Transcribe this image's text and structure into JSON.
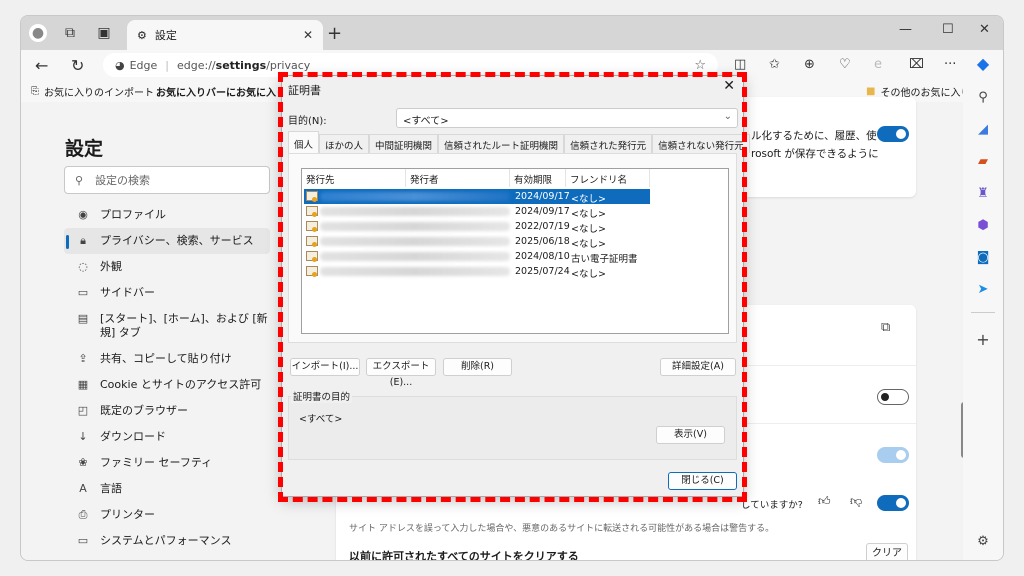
{
  "browser": {
    "tab_title": "設定",
    "url_brand": "Edge",
    "url_prefix": "edge://",
    "url_bold": "settings",
    "url_suffix": "/privacy",
    "favorites_bar": {
      "import": "お気に入りのインポート",
      "hint": "お気に入りバーにお気に入りを追",
      "other": "その他のお気に入り"
    }
  },
  "settings": {
    "title": "設定",
    "search_placeholder": "設定の検索",
    "menu": [
      {
        "icon": "profile-icon",
        "glyph": "◉",
        "label": "プロファイル"
      },
      {
        "icon": "lock-icon",
        "glyph": "🔒︎",
        "label": "プライバシー、検索、サービス",
        "active": true
      },
      {
        "icon": "appearance-icon",
        "glyph": "◌",
        "label": "外観"
      },
      {
        "icon": "sidebar-icon",
        "glyph": "▭",
        "label": "サイドバー"
      },
      {
        "icon": "newtab-icon",
        "glyph": "▤",
        "label": "[スタート]、[ホーム]、および [新規] タブ"
      },
      {
        "icon": "share-icon",
        "glyph": "⇪",
        "label": "共有、コピーして貼り付け"
      },
      {
        "icon": "cookie-icon",
        "glyph": "▦",
        "label": "Cookie とサイトのアクセス許可"
      },
      {
        "icon": "default-browser-icon",
        "glyph": "◰",
        "label": "既定のブラウザー"
      },
      {
        "icon": "download-icon",
        "glyph": "↓",
        "label": "ダウンロード"
      },
      {
        "icon": "family-icon",
        "glyph": "❀",
        "label": "ファミリー セーフティ"
      },
      {
        "icon": "language-icon",
        "glyph": "A",
        "label": "言語"
      },
      {
        "icon": "printer-icon",
        "glyph": "⎙",
        "label": "プリンター"
      },
      {
        "icon": "system-icon",
        "glyph": "▭",
        "label": "システムとパフォーマンス"
      }
    ],
    "card1_line1": "ル化するために、履歴、使",
    "card1_line2": "rosoft が保存できるように",
    "feedback_text": "していますか?",
    "typo_desc": "サイト アドレスを誤って入力した場合や、悪意のあるサイトに転送される可能性がある場合は警告する。",
    "clear_title": "以前に許可されたすべてのサイトをクリアする",
    "clear_button": "クリア"
  },
  "dialog": {
    "title": "証明書",
    "purpose_label": "目的(N):",
    "purpose_value": "<すべて>",
    "tabs": [
      "個人",
      "ほかの人",
      "中間証明機関",
      "信頼されたルート証明機関",
      "信頼された発行元",
      "信頼されない発行元"
    ],
    "columns": [
      "発行先",
      "発行者",
      "有効期限",
      "フレンドリ名"
    ],
    "rows": [
      {
        "expires": "2024/09/17",
        "friendly": "<なし>",
        "selected": true
      },
      {
        "expires": "2024/09/17",
        "friendly": "<なし>"
      },
      {
        "expires": "2022/07/19",
        "friendly": "<なし>"
      },
      {
        "expires": "2025/06/18",
        "friendly": "<なし>"
      },
      {
        "expires": "2024/08/10",
        "friendly": "古い電子証明書"
      },
      {
        "expires": "2025/07/24",
        "friendly": "<なし>"
      }
    ],
    "buttons": {
      "import": "インポート(I)...",
      "export": "エクスポート(E)...",
      "remove": "削除(R)",
      "advanced": "詳細設定(A)",
      "view": "表示(V)",
      "close": "閉じる(C)"
    },
    "group_label": "証明書の目的",
    "group_value": "<すべて>"
  }
}
